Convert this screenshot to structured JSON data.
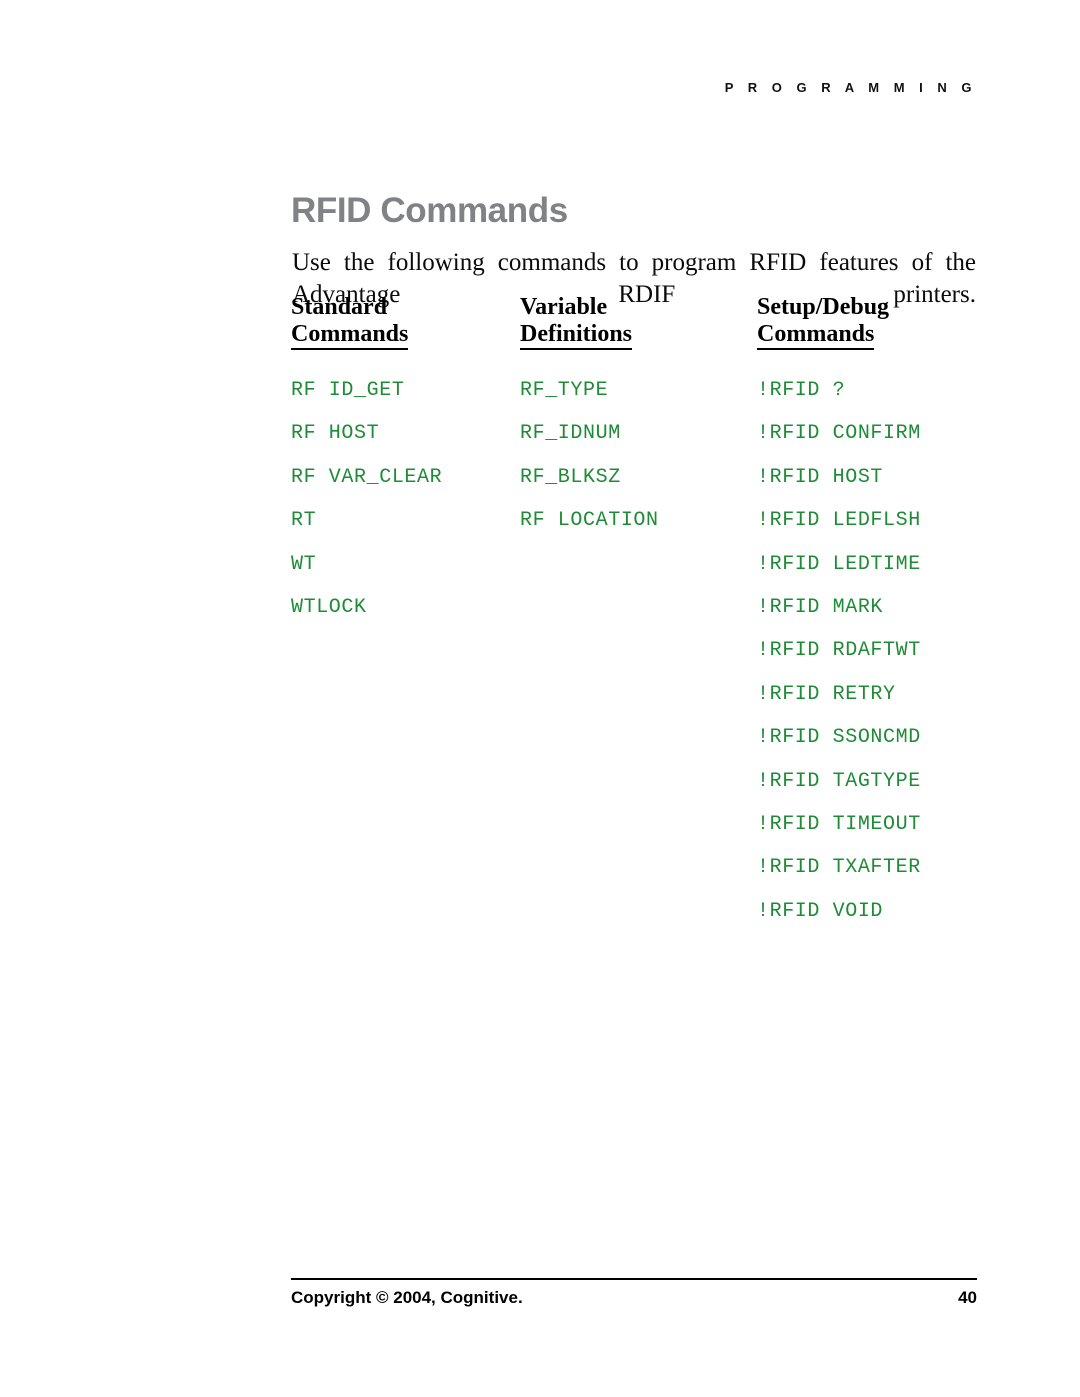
{
  "running_head": "P R O G R A M M I N G",
  "page": {
    "title": "RFID Commands",
    "intro": "Use the following commands to program RFID features of the Advantage RDIF printers."
  },
  "table": {
    "columns": [
      {
        "head_line_1": "Standard",
        "head_line_2": "Commands",
        "items": [
          "RF ID_GET",
          "RF HOST",
          "RF VAR_CLEAR",
          "RT",
          "WT",
          "WTLOCK"
        ]
      },
      {
        "head_line_1": "Variable",
        "head_line_2": "Definitions",
        "items": [
          "RF_TYPE",
          "RF_IDNUM",
          "RF_BLKSZ",
          "RF LOCATION"
        ]
      },
      {
        "head_line_1": "Setup/Debug",
        "head_line_2": "Commands",
        "items": [
          "!RFID ?",
          "!RFID CONFIRM",
          "!RFID HOST",
          "!RFID LEDFLSH",
          "!RFID LEDTIME",
          "!RFID MARK",
          "!RFID RDAFTWT",
          "!RFID RETRY",
          "!RFID SSONCMD",
          "!RFID TAGTYPE",
          "!RFID TIMEOUT",
          "!RFID TXAFTER",
          "!RFID VOID"
        ]
      }
    ]
  },
  "footer": {
    "copyright": "Copyright © 2004, Cognitive.",
    "page_number": "40"
  },
  "colors": {
    "command_green": "#1e8b36",
    "title_gray": "#808285",
    "text_black": "#000000",
    "page_background": "#ffffff"
  }
}
